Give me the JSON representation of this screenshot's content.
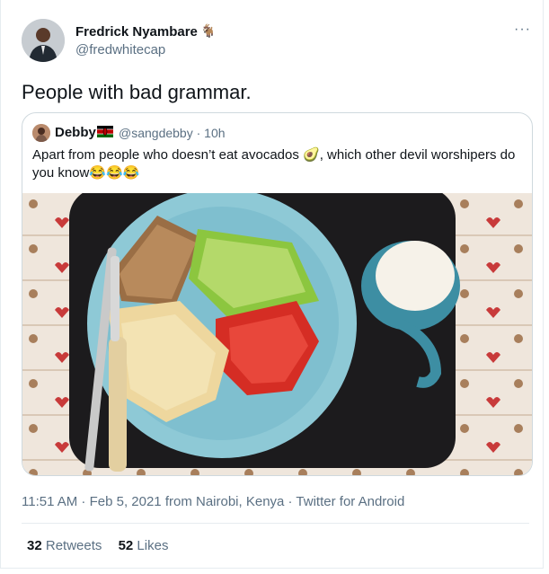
{
  "author": {
    "name": "Fredrick Nyambare",
    "badge_icon": "goat-emoji",
    "handle": "@fredwhitecap"
  },
  "menu_icon": "more-icon",
  "tweet": {
    "text": "People with bad grammar."
  },
  "quoted": {
    "name": "Debby",
    "flag_icon": "kenya-flag-icon",
    "handle": "@sangdebby · 10h",
    "text": "Apart from people who doesn’t eat avocados 🥑, which other devil worshipers do you know😂😂😂"
  },
  "meta": "11:51 AM · Feb 5, 2021 from Nairobi, Kenya · Twitter for Android",
  "stats": {
    "retweets_count": "32",
    "retweets_label": "Retweets",
    "likes_count": "52",
    "likes_label": "Likes"
  },
  "colors": {
    "secondary_text": "#5b7083",
    "border": "#cfd9de",
    "tray": "#1c1b1d",
    "plate": "#8ec9d6",
    "mug": "#3d8ea3"
  }
}
